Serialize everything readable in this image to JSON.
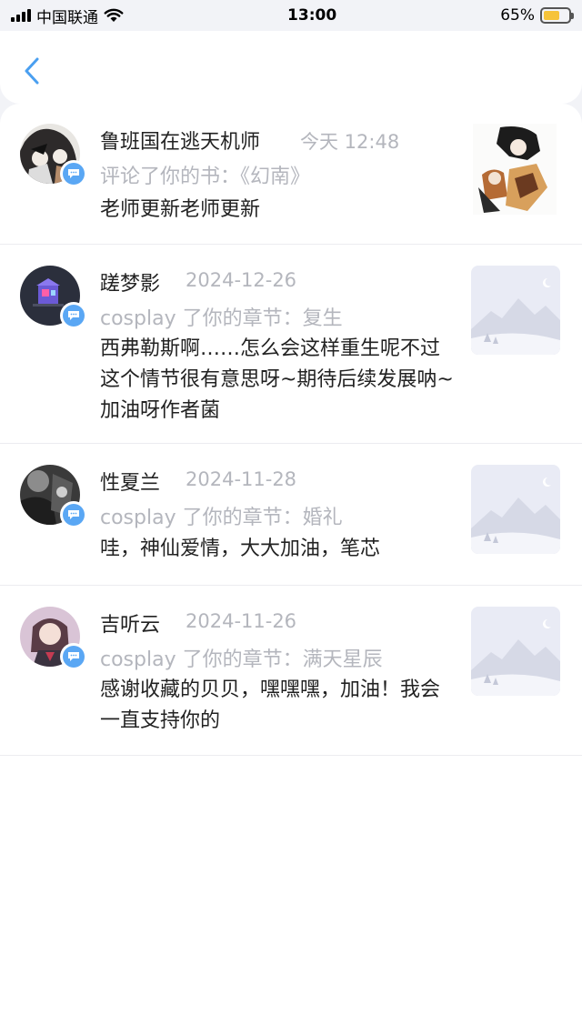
{
  "status_bar": {
    "carrier": "中国联通",
    "time": "13:00",
    "battery": "65%",
    "battery_level": 0.65,
    "battery_color": "#f6c339"
  },
  "header": {
    "back_icon": "chevron-left-icon",
    "accent": "#4a9ff0"
  },
  "notifications": [
    {
      "name": "鲁班国在逃天机师",
      "time": "今天 12:48",
      "action": "评论了你的书：《幻南》",
      "comment": "老师更新老师更新",
      "avatar_icon": "manga-avatar-icon",
      "thumb_icon": "book-cover-icon"
    },
    {
      "name": "蹉梦影",
      "time": "2024-12-26",
      "action": "cosplay 了你的章节：复生",
      "comment": "西弗勒斯啊……怎么会这样重生呢不过这个情节很有意思呀~期待后续发展呐~加油呀作者菌",
      "avatar_icon": "pixel-house-avatar-icon",
      "thumb_icon": "mountain-placeholder-icon"
    },
    {
      "name": "性夏兰",
      "time": "2024-11-28",
      "action": "cosplay 了你的章节：婚礼",
      "comment": "哇，神仙爱情，大大加油，笔芯",
      "avatar_icon": "dark-photo-avatar-icon",
      "thumb_icon": "mountain-placeholder-icon"
    },
    {
      "name": "吉听云",
      "time": "2024-11-26",
      "action": "cosplay 了你的章节：满天星辰",
      "comment": "感谢收藏的贝贝，嘿嘿嘿，加油！我会一直支持你的",
      "avatar_icon": "girl-avatar-icon",
      "thumb_icon": "mountain-placeholder-icon"
    }
  ]
}
